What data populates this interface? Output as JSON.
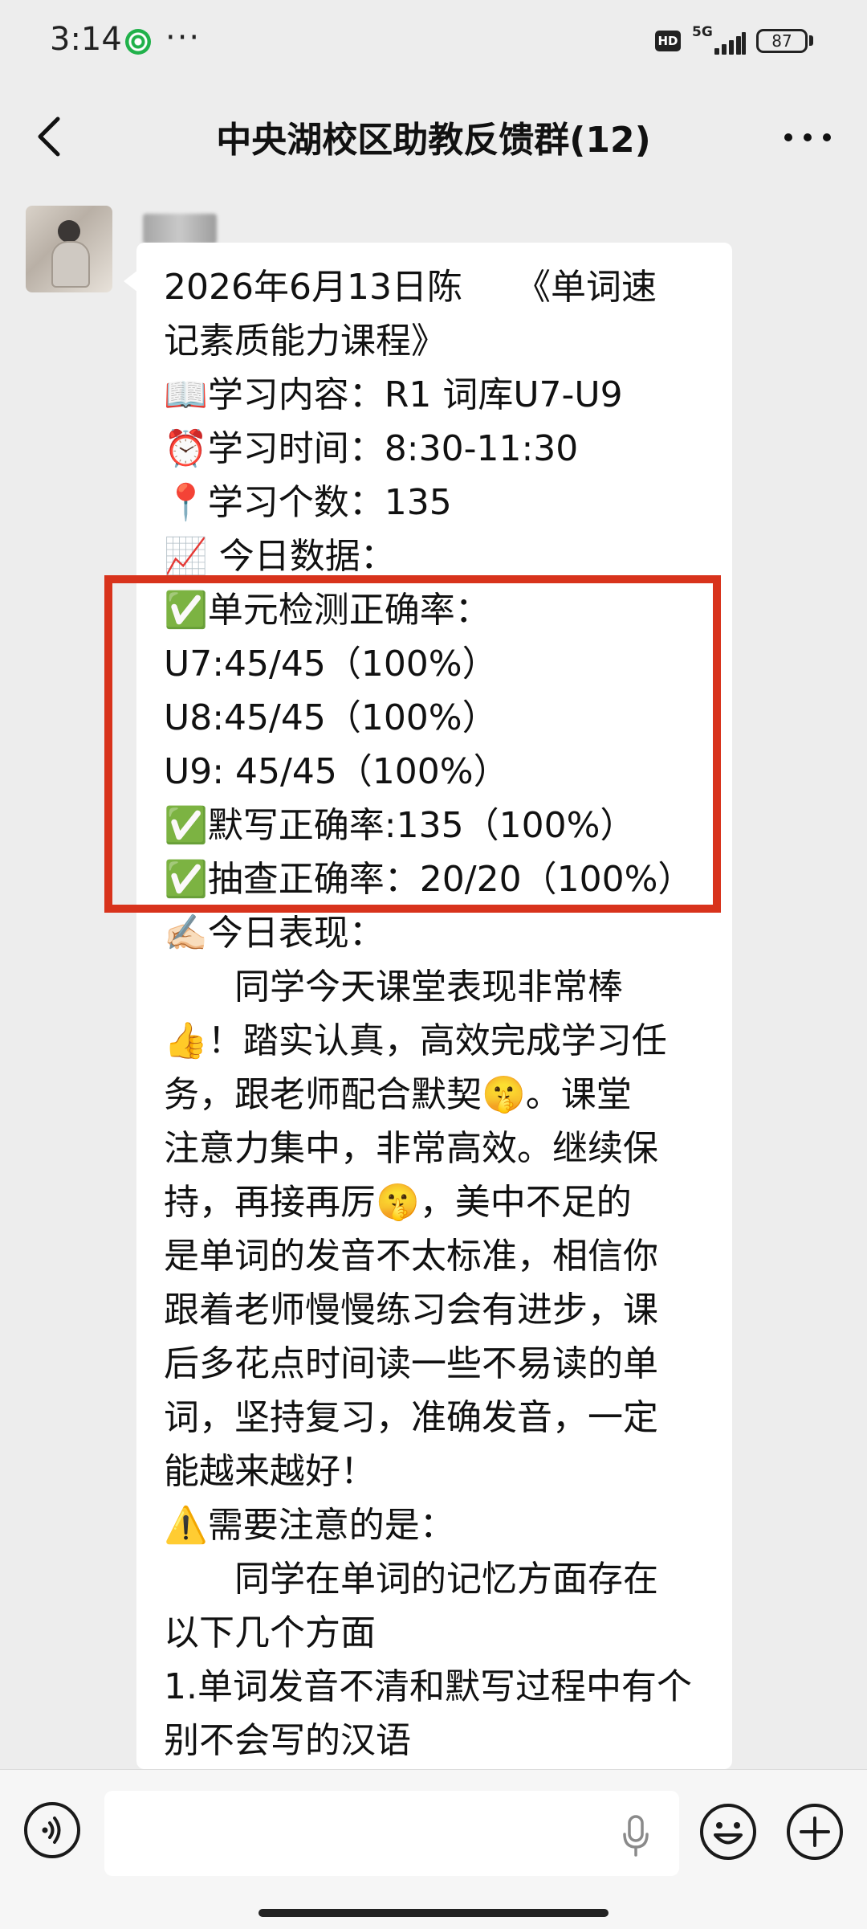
{
  "status_bar": {
    "time": "3:14",
    "more": "···",
    "hd": "HD",
    "network": "5G",
    "battery": "87",
    "icons": [
      "app-notification-icon",
      "signal-icon",
      "battery-icon"
    ]
  },
  "nav": {
    "title": "中央湖校区助教反馈群(12)",
    "icons": [
      "back-arrow-icon",
      "more-dots-icon"
    ]
  },
  "message": {
    "lines": [
      "2026年6月13日陈　　《单词速",
      "记素质能力课程》",
      "📖学习内容：R1 词库U7-U9",
      "⏰学习时间：8:30-11:30",
      "📍学习个数：135",
      "📈 今日数据：",
      "✅单元检测正确率：",
      "U7:45/45（100%）",
      "U8:45/45（100%）",
      "U9: 45/45（100%）",
      "✅默写正确率:135（100%）",
      "✅抽查正确率：20/20（100%）",
      "✍🏻今日表现：",
      "　　同学今天课堂表现非常棒",
      "👍！踏实认真，高效完成学习任",
      "务，跟老师配合默契🤫。课堂",
      "注意力集中，非常高效。继续保",
      "持，再接再厉🤫，美中不足的",
      "是单词的发音不太标准，相信你",
      "跟着老师慢慢练习会有进步，课",
      "后多花点时间读一些不易读的单",
      "词，坚持复习，准确发音，一定",
      "能越来越好！",
      "⚠️需要注意的是：",
      "　　同学在单词的记忆方面存在",
      "以下几个方面",
      "1.单词发音不清和默写过程中有个",
      "别不会写的汉语"
    ],
    "highlight_color": "#d8331c"
  },
  "input_bar": {
    "icons": [
      "voice-icon",
      "microphone-icon",
      "emoji-icon",
      "plus-icon"
    ]
  }
}
